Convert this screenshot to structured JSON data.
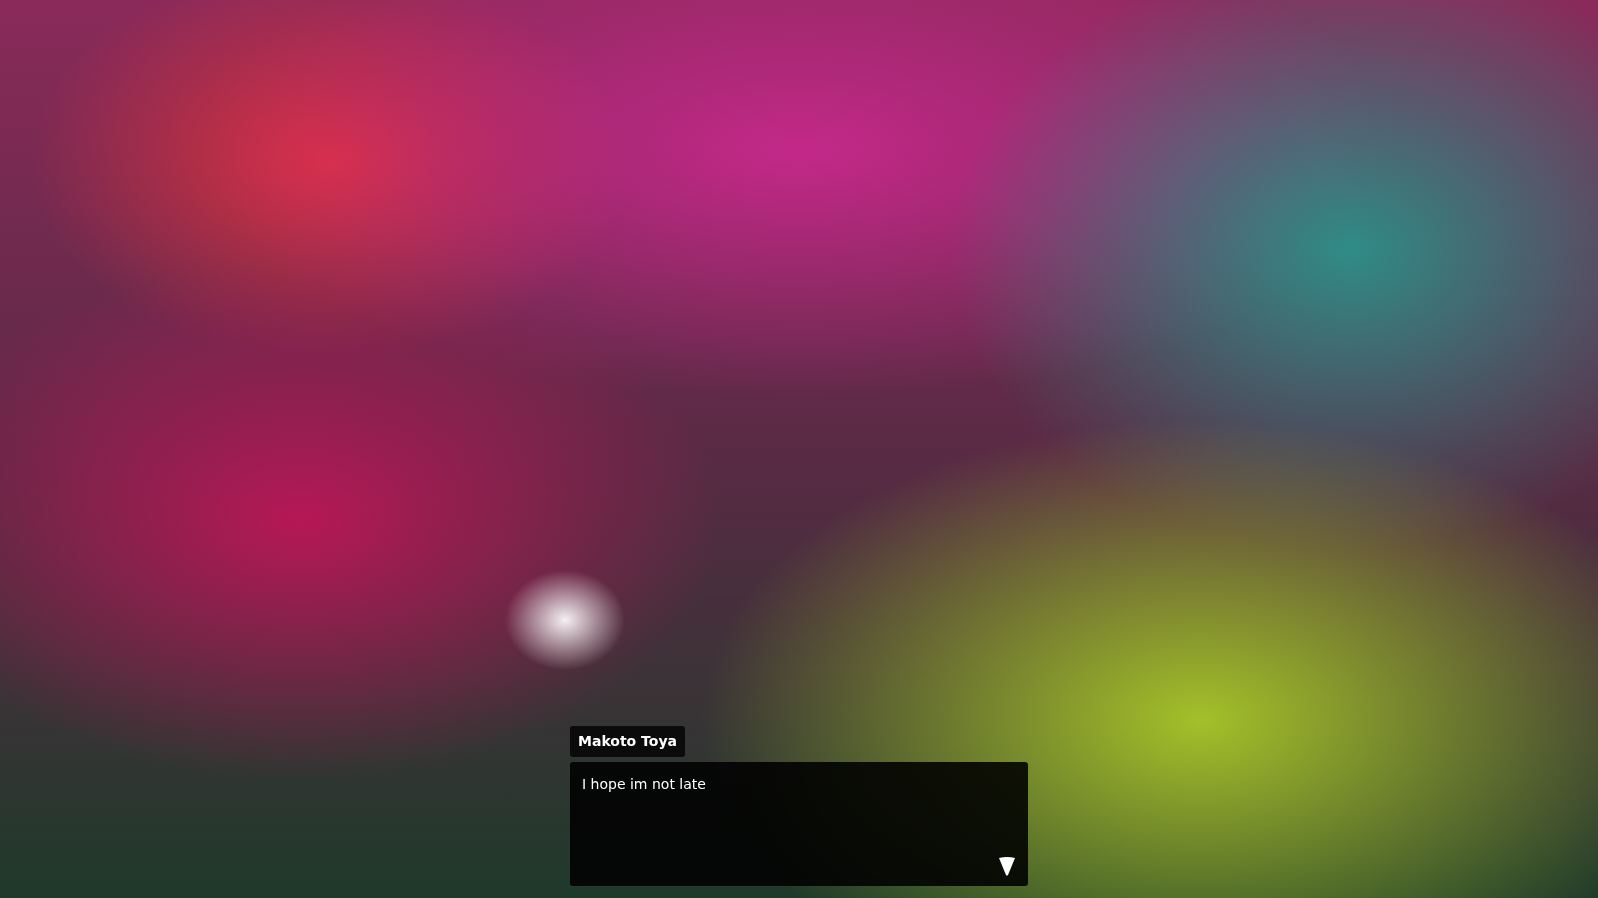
{
  "dialogue": {
    "speaker": "Makoto Toya",
    "text": "I hope im not late"
  }
}
